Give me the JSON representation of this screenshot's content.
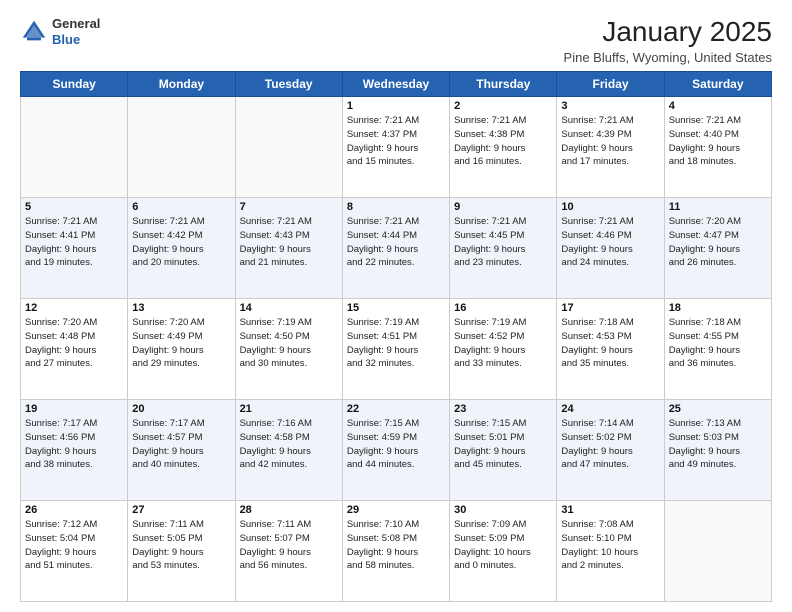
{
  "logo": {
    "general": "General",
    "blue": "Blue"
  },
  "header": {
    "month": "January 2025",
    "location": "Pine Bluffs, Wyoming, United States"
  },
  "weekdays": [
    "Sunday",
    "Monday",
    "Tuesday",
    "Wednesday",
    "Thursday",
    "Friday",
    "Saturday"
  ],
  "weeks": [
    [
      {
        "day": "",
        "info": ""
      },
      {
        "day": "",
        "info": ""
      },
      {
        "day": "",
        "info": ""
      },
      {
        "day": "1",
        "info": "Sunrise: 7:21 AM\nSunset: 4:37 PM\nDaylight: 9 hours\nand 15 minutes."
      },
      {
        "day": "2",
        "info": "Sunrise: 7:21 AM\nSunset: 4:38 PM\nDaylight: 9 hours\nand 16 minutes."
      },
      {
        "day": "3",
        "info": "Sunrise: 7:21 AM\nSunset: 4:39 PM\nDaylight: 9 hours\nand 17 minutes."
      },
      {
        "day": "4",
        "info": "Sunrise: 7:21 AM\nSunset: 4:40 PM\nDaylight: 9 hours\nand 18 minutes."
      }
    ],
    [
      {
        "day": "5",
        "info": "Sunrise: 7:21 AM\nSunset: 4:41 PM\nDaylight: 9 hours\nand 19 minutes."
      },
      {
        "day": "6",
        "info": "Sunrise: 7:21 AM\nSunset: 4:42 PM\nDaylight: 9 hours\nand 20 minutes."
      },
      {
        "day": "7",
        "info": "Sunrise: 7:21 AM\nSunset: 4:43 PM\nDaylight: 9 hours\nand 21 minutes."
      },
      {
        "day": "8",
        "info": "Sunrise: 7:21 AM\nSunset: 4:44 PM\nDaylight: 9 hours\nand 22 minutes."
      },
      {
        "day": "9",
        "info": "Sunrise: 7:21 AM\nSunset: 4:45 PM\nDaylight: 9 hours\nand 23 minutes."
      },
      {
        "day": "10",
        "info": "Sunrise: 7:21 AM\nSunset: 4:46 PM\nDaylight: 9 hours\nand 24 minutes."
      },
      {
        "day": "11",
        "info": "Sunrise: 7:20 AM\nSunset: 4:47 PM\nDaylight: 9 hours\nand 26 minutes."
      }
    ],
    [
      {
        "day": "12",
        "info": "Sunrise: 7:20 AM\nSunset: 4:48 PM\nDaylight: 9 hours\nand 27 minutes."
      },
      {
        "day": "13",
        "info": "Sunrise: 7:20 AM\nSunset: 4:49 PM\nDaylight: 9 hours\nand 29 minutes."
      },
      {
        "day": "14",
        "info": "Sunrise: 7:19 AM\nSunset: 4:50 PM\nDaylight: 9 hours\nand 30 minutes."
      },
      {
        "day": "15",
        "info": "Sunrise: 7:19 AM\nSunset: 4:51 PM\nDaylight: 9 hours\nand 32 minutes."
      },
      {
        "day": "16",
        "info": "Sunrise: 7:19 AM\nSunset: 4:52 PM\nDaylight: 9 hours\nand 33 minutes."
      },
      {
        "day": "17",
        "info": "Sunrise: 7:18 AM\nSunset: 4:53 PM\nDaylight: 9 hours\nand 35 minutes."
      },
      {
        "day": "18",
        "info": "Sunrise: 7:18 AM\nSunset: 4:55 PM\nDaylight: 9 hours\nand 36 minutes."
      }
    ],
    [
      {
        "day": "19",
        "info": "Sunrise: 7:17 AM\nSunset: 4:56 PM\nDaylight: 9 hours\nand 38 minutes."
      },
      {
        "day": "20",
        "info": "Sunrise: 7:17 AM\nSunset: 4:57 PM\nDaylight: 9 hours\nand 40 minutes."
      },
      {
        "day": "21",
        "info": "Sunrise: 7:16 AM\nSunset: 4:58 PM\nDaylight: 9 hours\nand 42 minutes."
      },
      {
        "day": "22",
        "info": "Sunrise: 7:15 AM\nSunset: 4:59 PM\nDaylight: 9 hours\nand 44 minutes."
      },
      {
        "day": "23",
        "info": "Sunrise: 7:15 AM\nSunset: 5:01 PM\nDaylight: 9 hours\nand 45 minutes."
      },
      {
        "day": "24",
        "info": "Sunrise: 7:14 AM\nSunset: 5:02 PM\nDaylight: 9 hours\nand 47 minutes."
      },
      {
        "day": "25",
        "info": "Sunrise: 7:13 AM\nSunset: 5:03 PM\nDaylight: 9 hours\nand 49 minutes."
      }
    ],
    [
      {
        "day": "26",
        "info": "Sunrise: 7:12 AM\nSunset: 5:04 PM\nDaylight: 9 hours\nand 51 minutes."
      },
      {
        "day": "27",
        "info": "Sunrise: 7:11 AM\nSunset: 5:05 PM\nDaylight: 9 hours\nand 53 minutes."
      },
      {
        "day": "28",
        "info": "Sunrise: 7:11 AM\nSunset: 5:07 PM\nDaylight: 9 hours\nand 56 minutes."
      },
      {
        "day": "29",
        "info": "Sunrise: 7:10 AM\nSunset: 5:08 PM\nDaylight: 9 hours\nand 58 minutes."
      },
      {
        "day": "30",
        "info": "Sunrise: 7:09 AM\nSunset: 5:09 PM\nDaylight: 10 hours\nand 0 minutes."
      },
      {
        "day": "31",
        "info": "Sunrise: 7:08 AM\nSunset: 5:10 PM\nDaylight: 10 hours\nand 2 minutes."
      },
      {
        "day": "",
        "info": ""
      }
    ]
  ]
}
